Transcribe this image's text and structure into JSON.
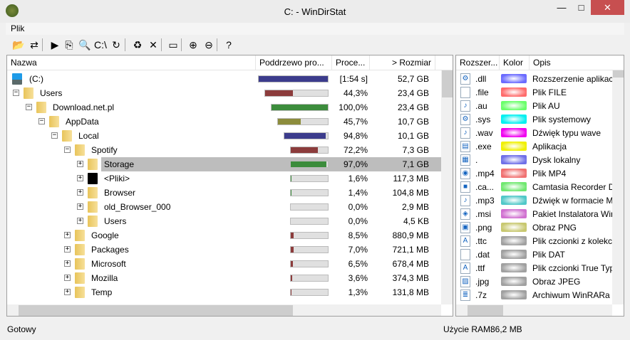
{
  "window": {
    "title": "C: - WinDirStat",
    "min": "—",
    "max": "□",
    "close": "✕"
  },
  "menu": [
    "Plik"
  ],
  "toolbar": [
    {
      "icon": "open-icon",
      "g": "📂"
    },
    {
      "icon": "refresh-all-icon",
      "g": "⇄"
    },
    {
      "icon": "play-icon",
      "g": "▶"
    },
    {
      "icon": "copy-path-icon",
      "g": "⎘"
    },
    {
      "icon": "explorer-icon",
      "g": "🔍"
    },
    {
      "icon": "cmd-icon",
      "g": "C:\\"
    },
    {
      "icon": "refresh-icon",
      "g": "↻"
    },
    {
      "icon": "recycle-bin-icon",
      "g": "♻"
    },
    {
      "icon": "delete-icon",
      "g": "✕"
    },
    {
      "icon": "properties-icon",
      "g": "▭"
    },
    {
      "icon": "zoom-in-icon",
      "g": "⊕"
    },
    {
      "icon": "zoom-out-icon",
      "g": "⊖"
    },
    {
      "icon": "help-icon",
      "g": "?"
    }
  ],
  "tree": {
    "columns": [
      "Nazwa",
      "Poddrzewo pro...",
      "Proce...",
      "> Rozmiar"
    ],
    "rows": [
      {
        "name": "(C:)",
        "depth": 0,
        "exp": "",
        "icon": "drive",
        "fill": 1,
        "color": "#3c3c8c",
        "pct": "[1:54 s]",
        "size": "52,7 GB"
      },
      {
        "name": "Users",
        "depth": 1,
        "exp": "−",
        "icon": "folder",
        "fill": 0.443,
        "color": "#8c3c3c",
        "pct": "44,3%",
        "size": "23,4 GB"
      },
      {
        "name": "Download.net.pl",
        "depth": 2,
        "exp": "−",
        "icon": "folder",
        "fill": 1,
        "color": "#3c8c3c",
        "pct": "100,0%",
        "size": "23,4 GB"
      },
      {
        "name": "AppData",
        "depth": 3,
        "exp": "−",
        "icon": "folder",
        "fill": 0.457,
        "color": "#8c8c3c",
        "pct": "45,7%",
        "size": "10,7 GB"
      },
      {
        "name": "Local",
        "depth": 4,
        "exp": "−",
        "icon": "folder",
        "fill": 0.948,
        "color": "#3c3c8c",
        "pct": "94,8%",
        "size": "10,1 GB"
      },
      {
        "name": "Spotify",
        "depth": 5,
        "exp": "−",
        "icon": "folder",
        "fill": 0.722,
        "color": "#8c3c3c",
        "pct": "72,2%",
        "size": "7,3 GB"
      },
      {
        "name": "Storage",
        "depth": 6,
        "exp": "+",
        "icon": "folder",
        "fill": 0.97,
        "color": "#3c8c3c",
        "pct": "97,0%",
        "size": "7,1 GB",
        "selected": true
      },
      {
        "name": "<Pliki>",
        "depth": 6,
        "exp": "+",
        "icon": "files",
        "fill": 0.016,
        "color": "#3c8c3c",
        "pct": "1,6%",
        "size": "117,3 MB"
      },
      {
        "name": "Browser",
        "depth": 6,
        "exp": "+",
        "icon": "folder",
        "fill": 0.014,
        "color": "#3c8c3c",
        "pct": "1,4%",
        "size": "104,8 MB"
      },
      {
        "name": "old_Browser_000",
        "depth": 6,
        "exp": "+",
        "icon": "folder",
        "fill": 0,
        "color": "#3c8c3c",
        "pct": "0,0%",
        "size": "2,9 MB"
      },
      {
        "name": "Users",
        "depth": 6,
        "exp": "+",
        "icon": "folder",
        "fill": 0,
        "color": "#3c8c3c",
        "pct": "0,0%",
        "size": "4,5 KB"
      },
      {
        "name": "Google",
        "depth": 5,
        "exp": "+",
        "icon": "folder",
        "fill": 0.085,
        "color": "#8c3c3c",
        "pct": "8,5%",
        "size": "880,9 MB"
      },
      {
        "name": "Packages",
        "depth": 5,
        "exp": "+",
        "icon": "folder",
        "fill": 0.07,
        "color": "#8c3c3c",
        "pct": "7,0%",
        "size": "721,1 MB"
      },
      {
        "name": "Microsoft",
        "depth": 5,
        "exp": "+",
        "icon": "folder",
        "fill": 0.065,
        "color": "#8c3c3c",
        "pct": "6,5%",
        "size": "678,4 MB"
      },
      {
        "name": "Mozilla",
        "depth": 5,
        "exp": "+",
        "icon": "folder",
        "fill": 0.036,
        "color": "#8c3c3c",
        "pct": "3,6%",
        "size": "374,3 MB"
      },
      {
        "name": "Temp",
        "depth": 5,
        "exp": "+",
        "icon": "folder",
        "fill": 0.013,
        "color": "#8c3c3c",
        "pct": "1,3%",
        "size": "131,8 MB"
      }
    ]
  },
  "ext": {
    "columns": [
      "Rozszer...",
      "Kolor",
      "Opis"
    ],
    "rows": [
      {
        "ext": ".dll",
        "color": "#6b6bff",
        "desc": "Rozszerzenie aplikacji",
        "g": "⚙"
      },
      {
        "ext": ".file",
        "color": "#ff6b6b",
        "desc": "Plik FILE",
        "g": ""
      },
      {
        "ext": ".au",
        "color": "#6bff6b",
        "desc": "Plik AU",
        "g": "♪"
      },
      {
        "ext": ".sys",
        "color": "#00f0f0",
        "desc": "Plik systemowy",
        "g": "⚙"
      },
      {
        "ext": ".wav",
        "color": "#f000f0",
        "desc": "Dźwięk typu wave",
        "g": "♪"
      },
      {
        "ext": ".exe",
        "color": "#f0f000",
        "desc": "Aplikacja",
        "g": "▤"
      },
      {
        "ext": ".",
        "color": "#7070e8",
        "desc": "Dysk lokalny",
        "g": "▦"
      },
      {
        "ext": ".mp4",
        "color": "#f07070",
        "desc": "Plik MP4",
        "g": "◉"
      },
      {
        "ext": ".ca...",
        "color": "#70e870",
        "desc": "Camtasia Recorder D",
        "g": "■"
      },
      {
        "ext": ".mp3",
        "color": "#50c8c8",
        "desc": "Dźwięk w formacie M",
        "g": "♪"
      },
      {
        "ext": ".msi",
        "color": "#d070d0",
        "desc": "Pakiet Instalatora Wir",
        "g": "◈"
      },
      {
        "ext": ".png",
        "color": "#c8c870",
        "desc": "Obraz PNG",
        "g": "▣"
      },
      {
        "ext": ".ttc",
        "color": "#a0a0a0",
        "desc": "Plik czcionki z kolekc",
        "g": "A"
      },
      {
        "ext": ".dat",
        "color": "#a0a0a0",
        "desc": "Plik DAT",
        "g": ""
      },
      {
        "ext": ".ttf",
        "color": "#a0a0a0",
        "desc": "Plik czcionki True Typ",
        "g": "A"
      },
      {
        "ext": ".jpg",
        "color": "#a0a0a0",
        "desc": "Obraz JPEG",
        "g": "▨"
      },
      {
        "ext": ".7z",
        "color": "#a0a0a0",
        "desc": "Archiwum WinRARa",
        "g": "≣"
      }
    ]
  },
  "status": {
    "text": "Gotowy",
    "ram_label": "Użycie RAM:",
    "ram_value": "86,2 MB"
  }
}
